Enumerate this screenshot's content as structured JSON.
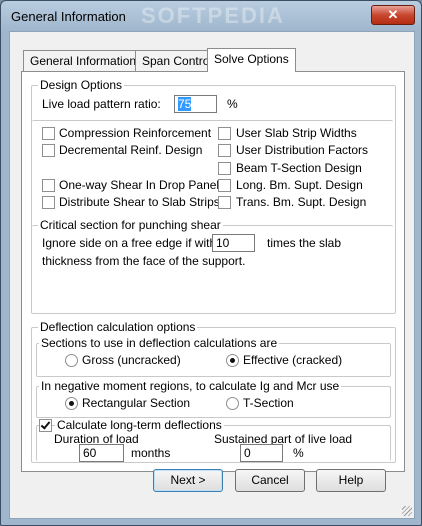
{
  "window": {
    "title": "General Information",
    "close_glyph": "✕",
    "watermark": "SOFTPEDIA"
  },
  "tabs": [
    {
      "label": "General Information"
    },
    {
      "label": "Span Control"
    },
    {
      "label": "Solve Options"
    }
  ],
  "design_options": {
    "legend": "Design Options",
    "live_load_label": "Live load pattern ratio:",
    "live_load_value": "75",
    "live_load_unit": "%",
    "checkboxes": [
      {
        "label": "Compression Reinforcement",
        "checked": false
      },
      {
        "label": "Decremental Reinf. Design",
        "checked": false
      },
      {
        "label": "One-way Shear In Drop Panels",
        "checked": false
      },
      {
        "label": "Distribute Shear to Slab Strips",
        "checked": false
      },
      {
        "label": "User Slab Strip Widths",
        "checked": false
      },
      {
        "label": "User Distribution Factors",
        "checked": false
      },
      {
        "label": "Beam T-Section Design",
        "checked": false
      },
      {
        "label": "Long. Bm. Supt. Design",
        "checked": false
      },
      {
        "label": "Trans. Bm. Supt. Design",
        "checked": false
      }
    ]
  },
  "punching": {
    "legend": "Critical section for punching shear",
    "text_before": "Ignore side on a free edge if within",
    "value": "10",
    "text_after": "times the slab",
    "text_line2": "thickness from the face of the support."
  },
  "deflection": {
    "legend": "Deflection calculation options",
    "sections": {
      "legend": "Sections to use in deflection calculations are",
      "options": [
        {
          "label": "Gross (uncracked)",
          "checked": false
        },
        {
          "label": "Effective (cracked)",
          "checked": true
        }
      ]
    },
    "negative": {
      "legend": "In negative moment regions, to calculate Ig and Mcr use",
      "options": [
        {
          "label": "Rectangular Section",
          "checked": true
        },
        {
          "label": "T-Section",
          "checked": false
        }
      ]
    },
    "longterm": {
      "label": "Calculate long-term deflections",
      "checked": true,
      "duration_label": "Duration of load",
      "duration_value": "60",
      "duration_unit": "months",
      "sustained_label": "Sustained part of live load",
      "sustained_value": "0",
      "sustained_unit": "%"
    }
  },
  "buttons": {
    "next": "Next >",
    "cancel": "Cancel",
    "help": "Help"
  }
}
